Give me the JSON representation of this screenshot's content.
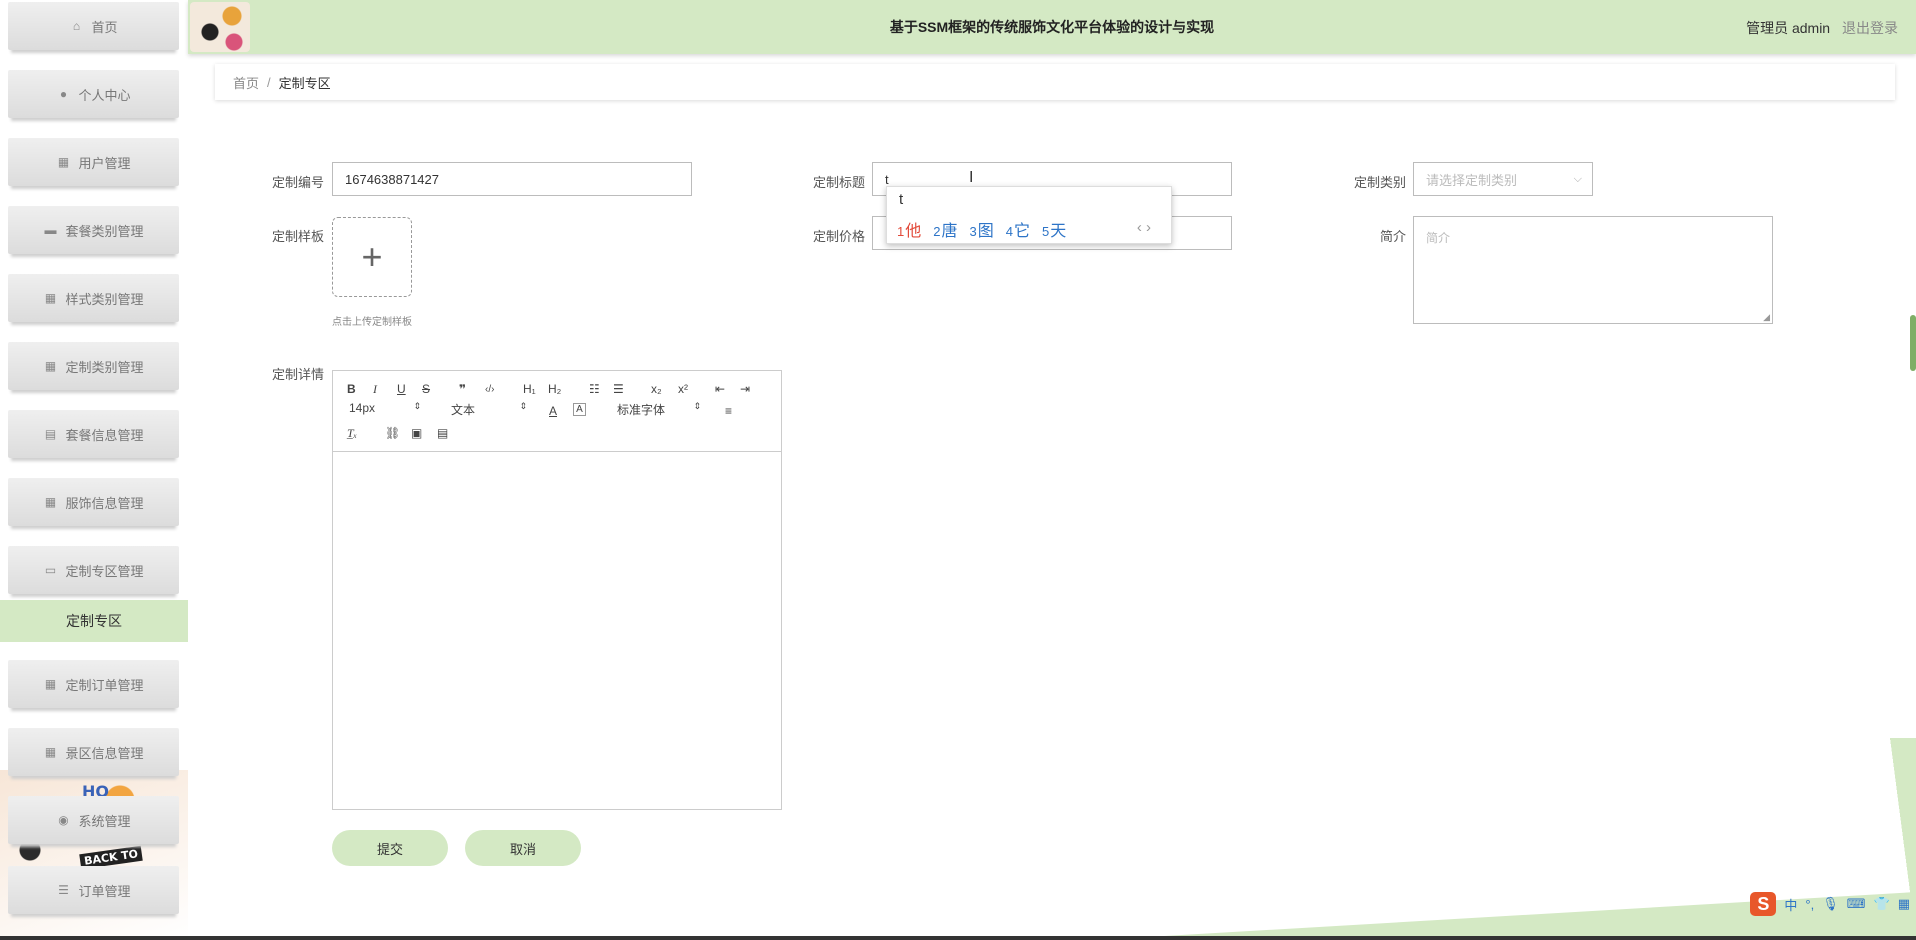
{
  "header": {
    "title": "基于SSM框架的传统服饰文化平台体验的设计与实现",
    "user_label": "管理员 admin",
    "logout_label": "退出登录"
  },
  "sidebar": {
    "items": [
      {
        "label": "首页",
        "icon": "home-icon"
      },
      {
        "label": "个人中心",
        "icon": "person-icon"
      },
      {
        "label": "用户管理",
        "icon": "grid-icon"
      },
      {
        "label": "套餐类别管理",
        "icon": "briefcase-icon"
      },
      {
        "label": "样式类别管理",
        "icon": "grid-icon"
      },
      {
        "label": "定制类别管理",
        "icon": "grid-icon"
      },
      {
        "label": "套餐信息管理",
        "icon": "clipboard-icon"
      },
      {
        "label": "服饰信息管理",
        "icon": "grid-icon"
      },
      {
        "label": "定制专区管理",
        "icon": "monitor-icon"
      },
      {
        "label": "定制订单管理",
        "icon": "grid-icon"
      },
      {
        "label": "景区信息管理",
        "icon": "grid-icon"
      },
      {
        "label": "系统管理",
        "icon": "pin-icon"
      },
      {
        "label": "订单管理",
        "icon": "list-icon"
      }
    ],
    "active_sub": "定制专区",
    "art_text_1": "HO",
    "art_text_2": "BACK TO"
  },
  "breadcrumb": {
    "home": "首页",
    "separator": "/",
    "current": "定制专区"
  },
  "form": {
    "custom_no_label": "定制编号",
    "custom_no_value": "1674638871427",
    "custom_title_label": "定制标题",
    "custom_title_value": "t",
    "custom_category_label": "定制类别",
    "custom_category_placeholder": "请选择定制类别",
    "sample_label": "定制样板",
    "upload_tip": "点击上传定制样板",
    "price_label": "定制价格",
    "intro_label": "简介",
    "intro_placeholder": "简介",
    "detail_label": "定制详情"
  },
  "editor": {
    "font_size": "14px",
    "block_format": "文本",
    "font_family": "标准字体"
  },
  "buttons": {
    "submit": "提交",
    "cancel": "取消"
  },
  "ime": {
    "composition": "t",
    "candidates": [
      {
        "num": "1",
        "text": "他"
      },
      {
        "num": "2",
        "text": "唐"
      },
      {
        "num": "3",
        "text": "图"
      },
      {
        "num": "4",
        "text": "它"
      },
      {
        "num": "5",
        "text": "天"
      }
    ],
    "nav": "‹ ›",
    "status_lang": "中",
    "brand_glyph": "S"
  },
  "colors": {
    "accent": "#d4e9c4",
    "active_sub": "#d4e9c4"
  }
}
